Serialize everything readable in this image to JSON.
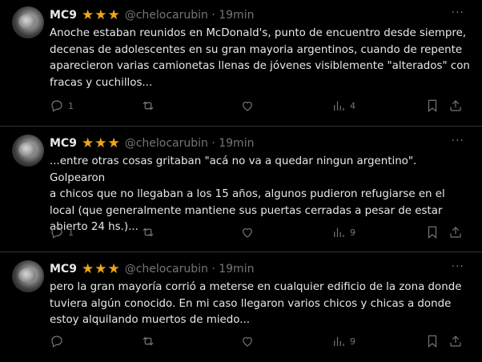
{
  "tweets": [
    {
      "name": "MC9",
      "handle": "@chelocarubin · 19min",
      "text": "Anoche estaban reunidos en McDonald's, punto de encuentro desde siempre,\ndecenas de adolescentes en su gran mayoria argentinos, cuando de repente\naparecieron varias camionetas llenas de jóvenes visiblemente \"alterados\" con\nfracas y cuchillos...",
      "replies": "1",
      "retweets": "",
      "likes": "",
      "views": "4"
    },
    {
      "name": "MC9",
      "handle": "@chelocarubin · 19min",
      "text": "...entre otras cosas gritaban \"acá no va a quedar ningun argentino\". Golpearon\na chicos que no llegaban a los 15 años, algunos pudieron refugiarse en el\nlocal (que generalmente mantiene sus puertas cerradas a pesar de estar\nabierto 24 hs.)...",
      "replies": "1",
      "retweets": "",
      "likes": "",
      "views": "9"
    },
    {
      "name": "MC9",
      "handle": "@chelocarubin · 19min",
      "text": "pero la gran mayoría corrió a meterse en cualquier edificio de la zona donde\ntuviera algún conocido. En mi caso llegaron varios chicos y chicas a donde\nestoy alquilando muertos de miedo...",
      "replies": "",
      "retweets": "",
      "likes": "",
      "views": "9"
    }
  ],
  "icons": {
    "reply": "reply-icon",
    "retweet": "retweet-icon",
    "like": "heart-icon",
    "views": "views-icon",
    "bookmark": "bookmark-icon",
    "share": "share-icon",
    "more": "more-icon",
    "star": "star-icon"
  },
  "colors": {
    "background": "#000000",
    "text": "#e7e9ea",
    "muted": "#71767b",
    "star": "#f0a51b",
    "divider": "#2f3336"
  },
  "glyphs": {
    "star": "★",
    "more": "···"
  }
}
